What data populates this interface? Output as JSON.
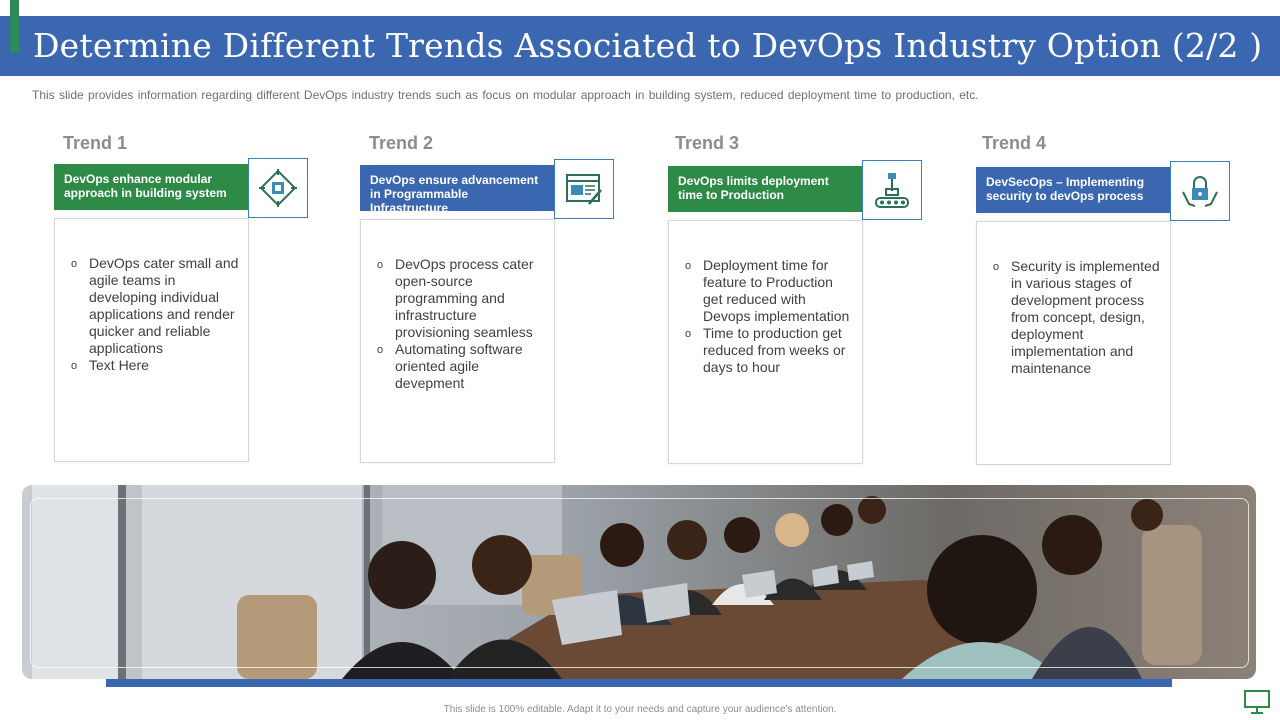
{
  "title": "Determine Different Trends Associated to DevOps Industry Option (2/2 )",
  "subtitle": "This slide provides  information  regarding  different  DevOps  industry trends such as focus on modular approach in building system, reduced deployment time to production, etc.",
  "trends": [
    {
      "heading": "Trend 1",
      "banner": "DevOps enhance modular approach in building  system",
      "icon": "chip-icon",
      "bullets": [
        "DevOps cater small and agile teams in developing individual applications and render quicker and reliable applications",
        "Text Here"
      ]
    },
    {
      "heading": "Trend 2",
      "banner": "DevOps  ensure advancement in Programmable Infrastructure",
      "icon": "code-editor-icon",
      "bullets": [
        "DevOps process cater open-source programming and infrastructure provisioning seamless",
        "Automating software oriented agile devepment"
      ]
    },
    {
      "heading": "Trend 3",
      "banner": "DevOps limits deployment time to Production",
      "icon": "assembly-line-icon",
      "bullets": [
        "Deployment time for feature to Production get reduced with Devops implementation",
        "Time to production get reduced from weeks or days to hour"
      ]
    },
    {
      "heading": "Trend 4",
      "banner": "DevSecOps – Implementing security to devOps process",
      "icon": "secure-lock-hands-icon",
      "bullets": [
        "Security is implemented in various stages of development process from concept, design, deployment implementation and maintenance"
      ]
    }
  ],
  "photo": {
    "description_icon": "meeting-photo"
  },
  "footer": "This slide is 100% editable. Adapt it to your needs and capture your audience's attention.",
  "colors": {
    "blue": "#3a67b0",
    "green": "#2e8b47",
    "icon_border": "#3a7fb5"
  }
}
